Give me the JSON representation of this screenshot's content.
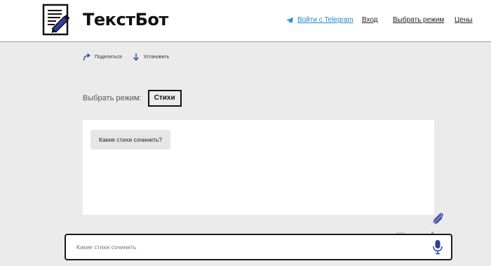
{
  "brand": {
    "name": "ТекстБот",
    "logo_icon": "document-pen-icon"
  },
  "nav": {
    "telegram_label": "Войти с Telegram",
    "telegram_icon": "telegram-icon",
    "login_label": "Вход",
    "mode_label": "Выбрать режим",
    "prices_label": "Цены"
  },
  "actions": {
    "share_label": "Поделиться",
    "share_icon": "share-arrow-icon",
    "install_label": "Установить",
    "install_icon": "download-arrow-icon"
  },
  "mode": {
    "label": "Выбрать режим:",
    "selected": "Стихи"
  },
  "chat": {
    "messages": [
      {
        "text": "Какие стихи сочинить?"
      }
    ]
  },
  "composer": {
    "placeholder": "Какие стихи сочинить",
    "value": "",
    "attach_icon": "paperclip-icon",
    "mic_icon": "microphone-icon"
  },
  "colors": {
    "background": "#ebebeb",
    "header": "#ffffff",
    "link_accent": "#1e8bc3",
    "icon_accent": "#2f3e9e"
  }
}
